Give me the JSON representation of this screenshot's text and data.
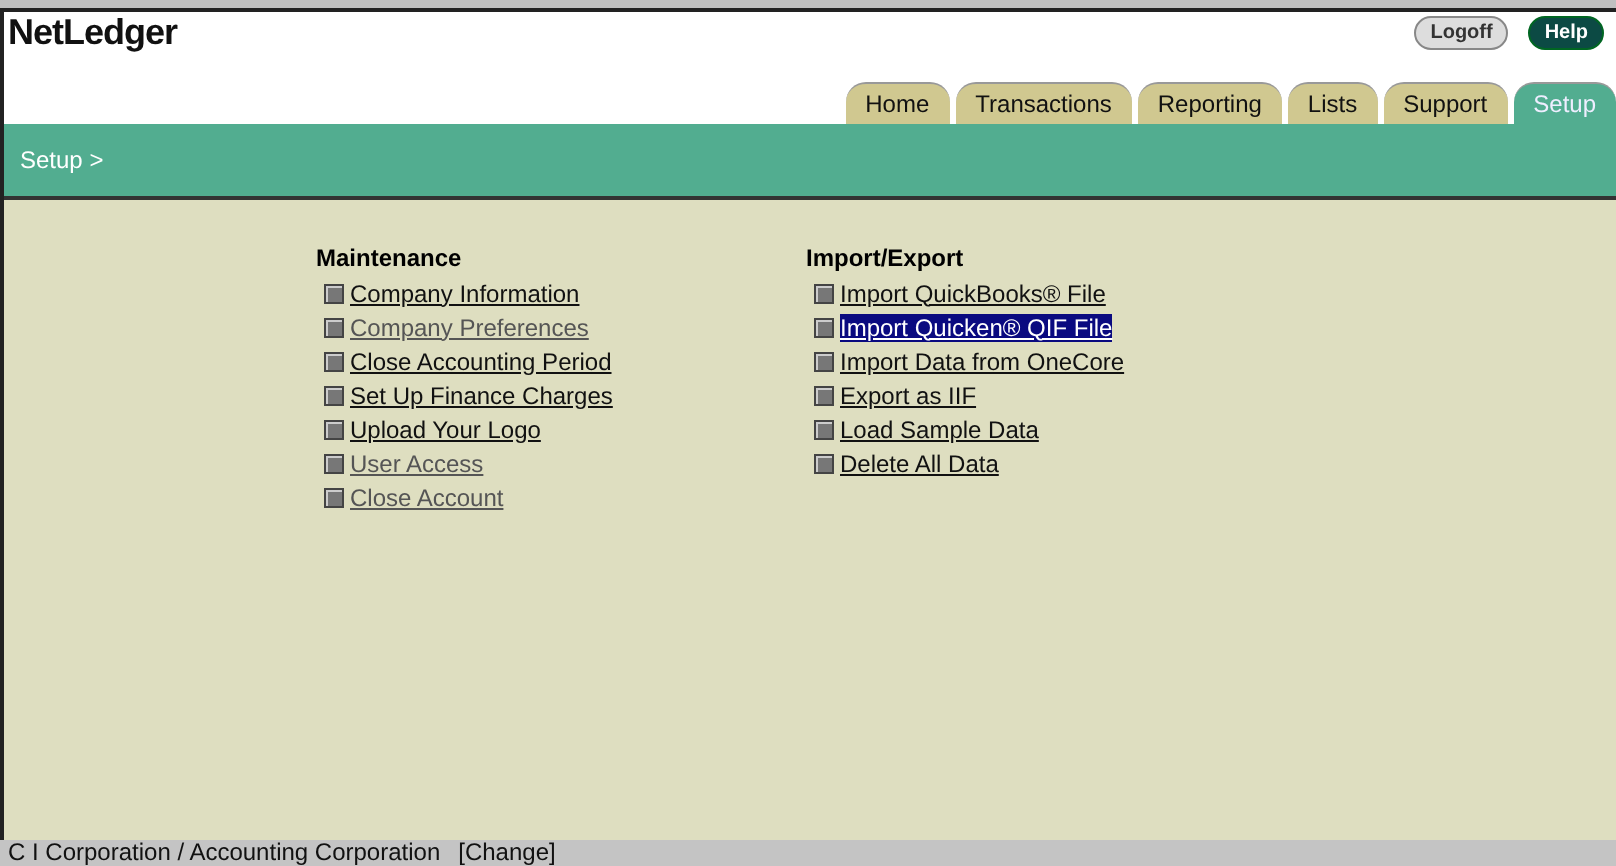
{
  "header": {
    "logo": "NetLedger",
    "buttons": [
      {
        "label": "Logoff",
        "kind": "light"
      },
      {
        "label": "Help",
        "kind": "dark"
      }
    ]
  },
  "tabs": [
    {
      "label": "Home",
      "selected": false
    },
    {
      "label": "Transactions",
      "selected": false
    },
    {
      "label": "Reporting",
      "selected": false
    },
    {
      "label": "Lists",
      "selected": false
    },
    {
      "label": "Support",
      "selected": false
    },
    {
      "label": "Setup",
      "selected": true
    }
  ],
  "breadcrumb": "Setup >",
  "sections": [
    {
      "title": "Maintenance",
      "links": [
        {
          "label": "Company Information",
          "visited": false,
          "selected": false
        },
        {
          "label": "Company Preferences",
          "visited": true,
          "selected": false
        },
        {
          "label": "Close Accounting Period",
          "visited": false,
          "selected": false
        },
        {
          "label": "Set Up Finance Charges",
          "visited": false,
          "selected": false
        },
        {
          "label": "Upload Your Logo",
          "visited": false,
          "selected": false
        },
        {
          "label": "User Access",
          "visited": true,
          "selected": false
        },
        {
          "label": "Close Account",
          "visited": true,
          "selected": false
        }
      ]
    },
    {
      "title": "Import/Export",
      "links": [
        {
          "label": "Import QuickBooks® File",
          "visited": false,
          "selected": false
        },
        {
          "label": "Import Quicken® QIF File",
          "visited": false,
          "selected": true
        },
        {
          "label": "Import Data from OneCore",
          "visited": false,
          "selected": false
        },
        {
          "label": "Export as IIF",
          "visited": false,
          "selected": false
        },
        {
          "label": "Load Sample Data",
          "visited": false,
          "selected": false
        },
        {
          "label": "Delete All Data",
          "visited": false,
          "selected": false
        }
      ]
    }
  ],
  "status_bar": {
    "company": "C I Corporation / Accounting Corporation",
    "link": "[Change]"
  }
}
